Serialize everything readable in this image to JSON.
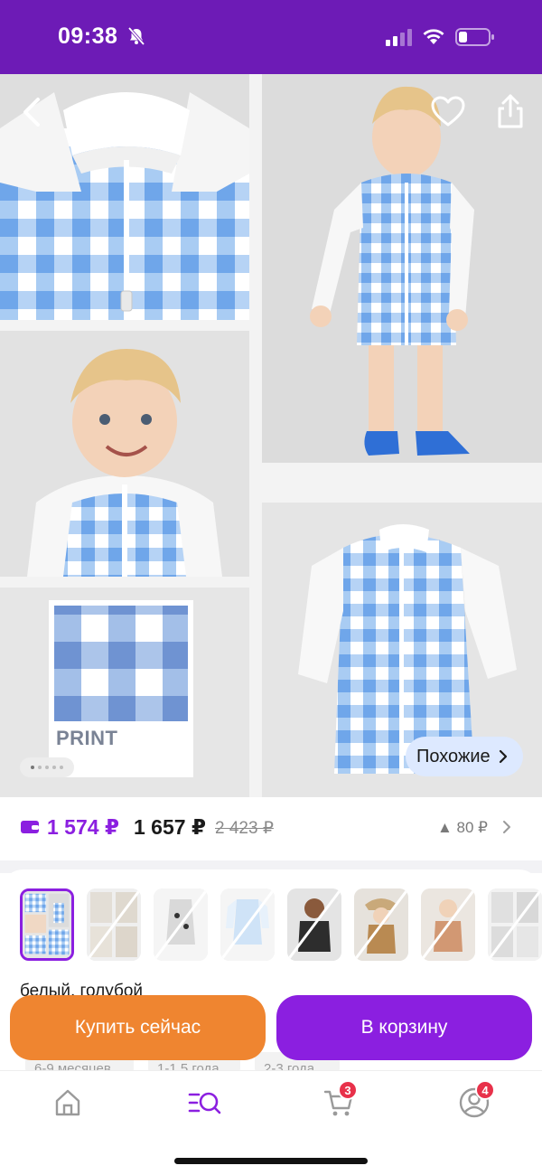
{
  "status_bar": {
    "time": "09:38"
  },
  "gallery": {
    "print_label": "PRINT",
    "similar_label": "Похожие",
    "page_count": 5,
    "active_page": 1
  },
  "price": {
    "wallet_price": "1 574 ₽",
    "price": "1 657 ₽",
    "old_price": "2 423 ₽",
    "change": "▲ 80 ₽"
  },
  "variants": {
    "color_name": "белый, голубой",
    "thumbnails": 9,
    "selected_index": 0
  },
  "sizes": [
    "6-9 месяцев",
    "1-1,5 года",
    "2-3 года"
  ],
  "sizes_partial_digit": "9",
  "actions": {
    "buy_now": "Купить сейчас",
    "add_to_cart": "В корзину"
  },
  "tabbar": {
    "items": [
      {
        "icon": "home-icon"
      },
      {
        "icon": "catalog-search-icon",
        "active": true
      },
      {
        "icon": "cart-icon",
        "badge": "3"
      },
      {
        "icon": "profile-icon",
        "badge": "4"
      }
    ]
  },
  "colors": {
    "brand_purple": "#8b1fe0",
    "status_purple": "#6d1bb6",
    "buy_orange": "#ef8530",
    "badge_red": "#e8314a"
  }
}
